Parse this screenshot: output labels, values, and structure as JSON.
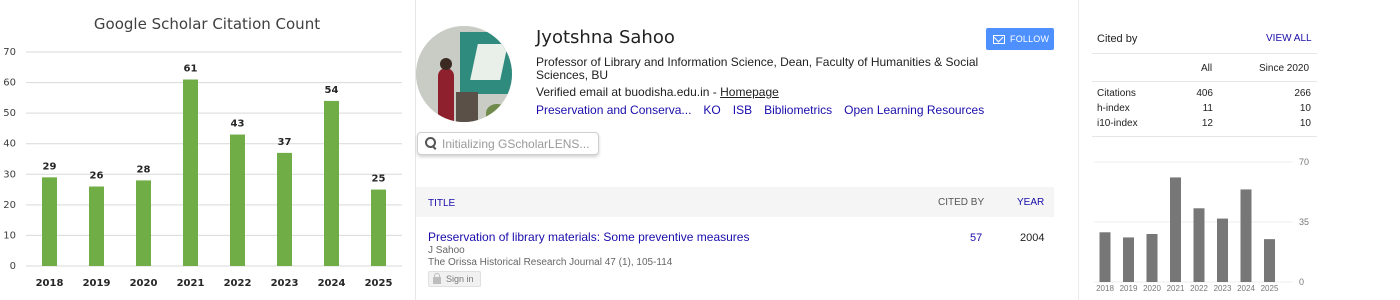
{
  "left_chart": {
    "title": "Google Scholar Citation Count",
    "y_ticks": [
      "0",
      "10",
      "20",
      "30",
      "40",
      "50",
      "60",
      "70"
    ],
    "bar_color": "#70ad47"
  },
  "profile": {
    "name": "Jyotshna Sahoo",
    "follow_label": "FOLLOW",
    "affiliation": "Professor of Library and Information Science, Dean, Faculty of Humanities & Social Sciences, BU",
    "email_text": "Verified email at buodisha.edu.in - ",
    "homepage_label": "Homepage",
    "interests": [
      "Preservation and Conserva...",
      "KO",
      "ISB",
      "Bibliometrics",
      "Open Learning Resources"
    ],
    "lens_placeholder": "Initializing GScholarLENS...",
    "table": {
      "col_title": "TITLE",
      "col_cited": "CITED BY",
      "col_year": "YEAR"
    },
    "publication": {
      "title": "Preservation of library materials: Some preventive measures",
      "authors": "J Sahoo",
      "venue": "The Orissa Historical Research Journal 47 (1), 105-114",
      "cited_by": "57",
      "year": "2004",
      "signin_label": "Sign in"
    }
  },
  "cited_by": {
    "title": "Cited by",
    "view_all": "VIEW ALL",
    "col_all": "All",
    "col_since": "Since 2020",
    "rows": [
      {
        "label": "Citations",
        "all": "406",
        "since": "266"
      },
      {
        "label": "h-index",
        "all": "11",
        "since": "10"
      },
      {
        "label": "i10-index",
        "all": "12",
        "since": "10"
      }
    ],
    "axis_ticks": [
      "70",
      "35",
      "0"
    ],
    "bar_color": "#777777"
  },
  "chart_data": [
    {
      "type": "bar",
      "title": "Google Scholar Citation Count",
      "categories": [
        "2018",
        "2019",
        "2020",
        "2021",
        "2022",
        "2023",
        "2024",
        "2025"
      ],
      "values": [
        29,
        26,
        28,
        61,
        43,
        37,
        54,
        25
      ],
      "ylim": [
        0,
        70
      ],
      "grid": true
    },
    {
      "type": "bar",
      "categories": [
        "2018",
        "2019",
        "2020",
        "2021",
        "2022",
        "2023",
        "2024",
        "2025"
      ],
      "values": [
        29,
        26,
        28,
        61,
        43,
        37,
        54,
        25
      ],
      "ylim": [
        0,
        70
      ],
      "grid": true
    }
  ]
}
